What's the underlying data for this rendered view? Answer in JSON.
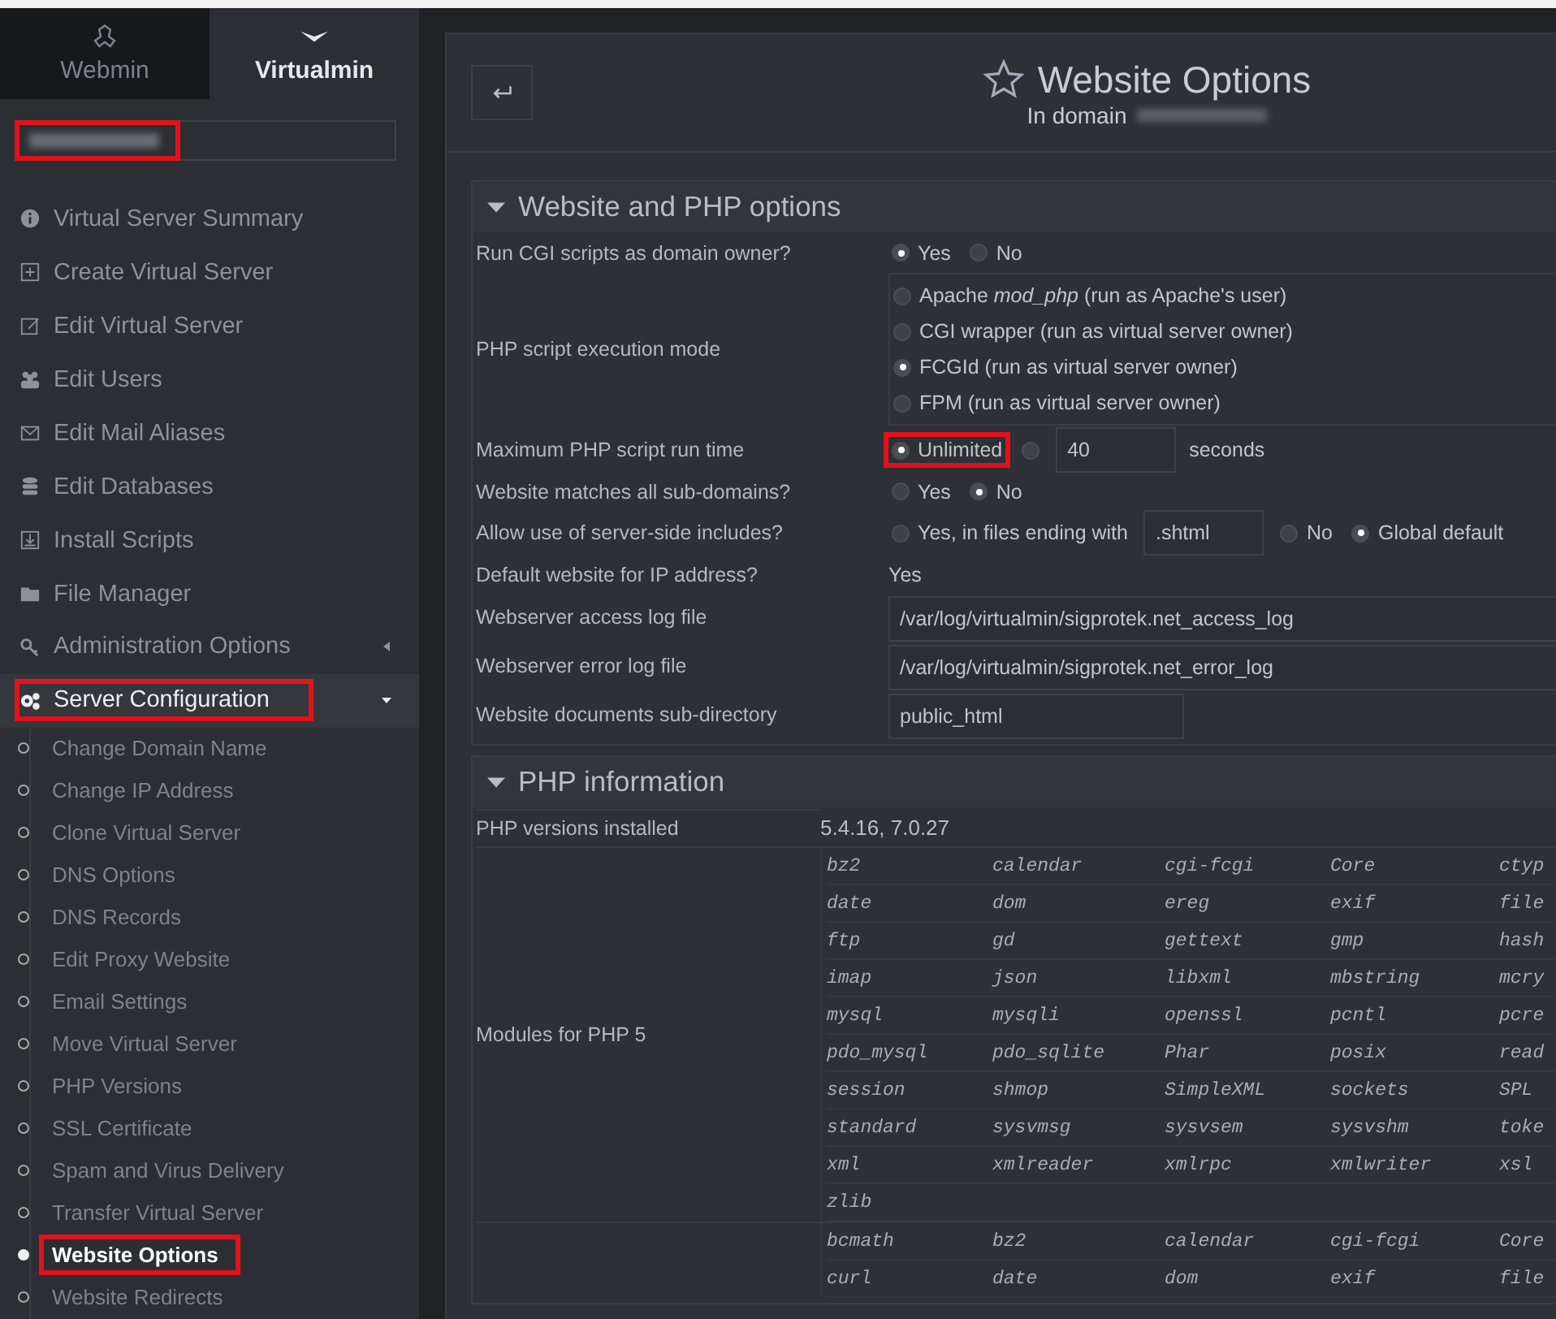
{
  "sidebar": {
    "tabs": [
      {
        "label": "Webmin",
        "selected": false
      },
      {
        "label": "Virtualmin",
        "selected": true
      }
    ],
    "domain_field": {
      "highlighted": true
    },
    "items": [
      {
        "label": "Virtual Server Summary"
      },
      {
        "label": "Create Virtual Server"
      },
      {
        "label": "Edit Virtual Server"
      },
      {
        "label": "Edit Users"
      },
      {
        "label": "Edit Mail Aliases"
      },
      {
        "label": "Edit Databases"
      },
      {
        "label": "Install Scripts"
      },
      {
        "label": "File Manager"
      },
      {
        "label": "Administration Options",
        "expanded": false,
        "highlighted": false
      },
      {
        "label": "Server Configuration",
        "expanded": true,
        "highlighted": true,
        "children": [
          {
            "label": "Change Domain Name",
            "selected": false,
            "highlighted": false
          },
          {
            "label": "Change IP Address",
            "selected": false,
            "highlighted": false
          },
          {
            "label": "Clone Virtual Server",
            "selected": false,
            "highlighted": false
          },
          {
            "label": "DNS Options",
            "selected": false,
            "highlighted": false
          },
          {
            "label": "DNS Records",
            "selected": false,
            "highlighted": false
          },
          {
            "label": "Edit Proxy Website",
            "selected": false,
            "highlighted": false
          },
          {
            "label": "Email Settings",
            "selected": false,
            "highlighted": false
          },
          {
            "label": "Move Virtual Server",
            "selected": false,
            "highlighted": false
          },
          {
            "label": "PHP Versions",
            "selected": false,
            "highlighted": false
          },
          {
            "label": "SSL Certificate",
            "selected": false,
            "highlighted": false
          },
          {
            "label": "Spam and Virus Delivery",
            "selected": false,
            "highlighted": false
          },
          {
            "label": "Transfer Virtual Server",
            "selected": false,
            "highlighted": false
          },
          {
            "label": "Website Options",
            "selected": true,
            "highlighted": true
          },
          {
            "label": "Website Redirects",
            "selected": false,
            "highlighted": false
          }
        ]
      }
    ]
  },
  "page": {
    "title": "Website Options",
    "subtitle": "In domain"
  },
  "sections": [
    {
      "title": "Website and PHP options",
      "expanded": true,
      "rows": [
        {
          "label": "Run CGI scripts as domain owner?",
          "kind": "inline",
          "controls": [
            {
              "kind": "radio",
              "label": "Yes",
              "selected": true
            },
            {
              "kind": "radio",
              "label": "No",
              "selected": false
            }
          ]
        },
        {
          "label": "PHP script execution mode",
          "kind": "stacked",
          "controls": [
            {
              "kind": "radio",
              "label": "Apache *mod_php* (run as Apache's user)",
              "selected": false
            },
            {
              "kind": "radio",
              "label": "CGI wrapper (run as virtual server owner)",
              "selected": false
            },
            {
              "kind": "radio",
              "label": "FCGId (run as virtual server owner)",
              "selected": true
            },
            {
              "kind": "radio",
              "label": "FPM (run as virtual server owner)",
              "selected": false
            }
          ]
        },
        {
          "label": "Maximum PHP script run time",
          "kind": "inline",
          "controls": [
            {
              "kind": "radio",
              "label": "Unlimited",
              "selected": true,
              "highlighted": true
            },
            {
              "kind": "radio",
              "selected": false
            },
            {
              "kind": "input",
              "value": "40"
            },
            {
              "kind": "text",
              "text": "seconds"
            }
          ]
        },
        {
          "label": "Website matches all sub-domains?",
          "kind": "inline",
          "controls": [
            {
              "kind": "radio",
              "label": "Yes",
              "selected": false
            },
            {
              "kind": "radio",
              "label": "No",
              "selected": true
            }
          ]
        },
        {
          "label": "Allow use of server-side includes?",
          "kind": "inline",
          "controls": [
            {
              "kind": "radio",
              "label": "Yes, in files ending with",
              "selected": false
            },
            {
              "kind": "input",
              "value": ".shtml"
            },
            {
              "kind": "radio",
              "label": "No",
              "selected": false
            },
            {
              "kind": "radio",
              "label": "Global default",
              "selected": true
            }
          ]
        },
        {
          "label": "Default website for IP address?",
          "kind": "inline",
          "controls": [
            {
              "kind": "text",
              "text": "Yes"
            }
          ]
        },
        {
          "label": "Webserver access log file",
          "kind": "inline",
          "controls": [
            {
              "kind": "wide_input",
              "value": "/var/log/virtualmin/sigprotek.net_access_log"
            }
          ]
        },
        {
          "label": "Webserver error log file",
          "kind": "inline",
          "controls": [
            {
              "kind": "wide_input",
              "value": "/var/log/virtualmin/sigprotek.net_error_log"
            }
          ]
        },
        {
          "label": "Website documents sub-directory",
          "kind": "inline",
          "controls": [
            {
              "kind": "input_medium",
              "value": "public_html"
            }
          ]
        }
      ]
    },
    {
      "title": "PHP information",
      "expanded": true,
      "rows": [
        {
          "label": "PHP versions installed",
          "kind": "value",
          "value": "5.4.16, 7.0.27"
        },
        {
          "label": "Modules for PHP 5",
          "kind": "modules",
          "modules": [
            [
              "bz2",
              "calendar",
              "cgi-fcgi",
              "Core",
              "ctyp"
            ],
            [
              "date",
              "dom",
              "ereg",
              "exif",
              "file"
            ],
            [
              "ftp",
              "gd",
              "gettext",
              "gmp",
              "hash"
            ],
            [
              "imap",
              "json",
              "libxml",
              "mbstring",
              "mcry"
            ],
            [
              "mysql",
              "mysqli",
              "openssl",
              "pcntl",
              "pcre"
            ],
            [
              "pdo_mysql",
              "pdo_sqlite",
              "Phar",
              "posix",
              "read"
            ],
            [
              "session",
              "shmop",
              "SimpleXML",
              "sockets",
              "SPL"
            ],
            [
              "standard",
              "sysvmsg",
              "sysvsem",
              "sysvshm",
              "toke"
            ],
            [
              "xml",
              "xmlreader",
              "xmlrpc",
              "xmlwriter",
              "xsl"
            ],
            [
              "zlib"
            ]
          ]
        },
        {
          "kind": "modules",
          "modules": [
            [
              "bcmath",
              "bz2",
              "calendar",
              "cgi-fcgi",
              "Core"
            ],
            [
              "curl",
              "date",
              "dom",
              "exif",
              "file"
            ]
          ]
        }
      ]
    }
  ]
}
